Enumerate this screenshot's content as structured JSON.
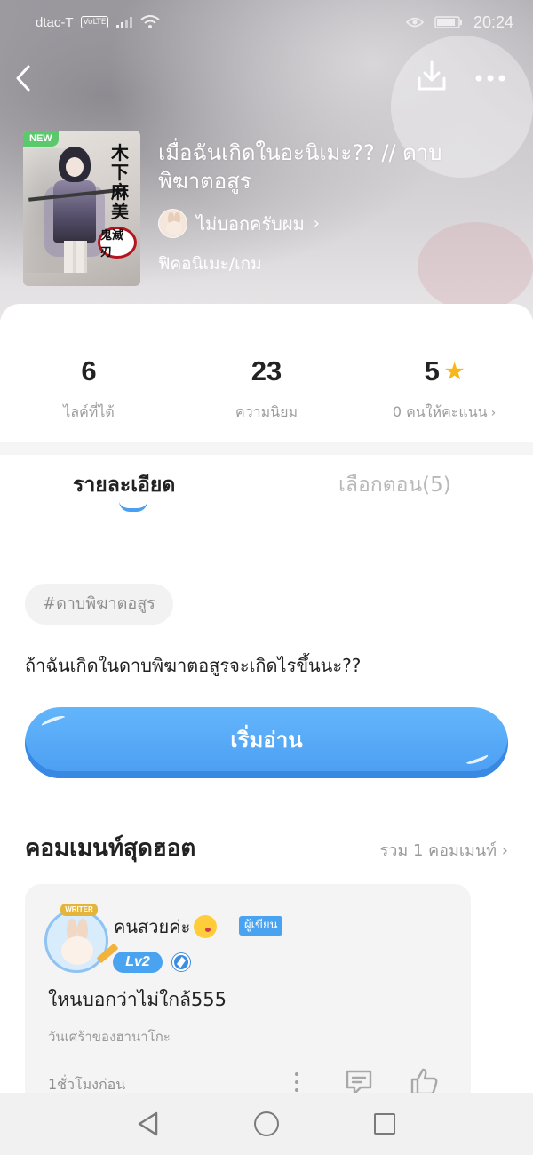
{
  "status_bar": {
    "carrier": "dtac-T",
    "network_badge": "VoLTE",
    "time": "20:24",
    "icons": [
      "signal-icon",
      "wifi-icon",
      "eye-icon",
      "battery-icon"
    ]
  },
  "nav": {
    "icons": [
      "back-arrow-icon",
      "download-icon",
      "more-icon"
    ]
  },
  "novel": {
    "new_badge": "NEW",
    "cover_kanji": "木下麻美",
    "cover_logo": "鬼滅刃",
    "title": "เมื่อฉันเกิดในอะนิเมะ?? // ดาบพิฆาตอสูร",
    "author": "ไม่บอกครับผม",
    "category": "ฟิคอนิเมะ/เกม"
  },
  "stats": [
    {
      "value": "6",
      "label": "ไลค์ที่ได้"
    },
    {
      "value": "23",
      "label": "ความนิยม"
    },
    {
      "value": "5",
      "label": "0 คนให้คะแนน"
    }
  ],
  "tabs": {
    "detail": "รายละเอียด",
    "chapters": "เลือกตอน(5)"
  },
  "tag": "#ดาบพิฆาตอสูร",
  "description": "ถ้าฉันเกิดในดาบพิฆาตอสูรจะเกิดไรขึ้นนะ??",
  "read_button": "เริ่มอ่าน",
  "comments_section": {
    "title": "คอมเมนท์สุดฮอต",
    "total": "รวม 1 คอมเมนท์"
  },
  "comment": {
    "writer_ribbon": "WRITER",
    "name": "คนสวยค่ะ",
    "badge": "ผู้เขียน",
    "level": "Lv2",
    "text": "ใหนบอกว่าไม่ใกล้555",
    "subtitle": "วันเศร้าของฮานาโกะ",
    "time": "1ชั่วโมงก่อน"
  },
  "colors": {
    "accent": "#4a9ff0",
    "star": "#f8b61b",
    "new_badge": "#5ac96b"
  }
}
